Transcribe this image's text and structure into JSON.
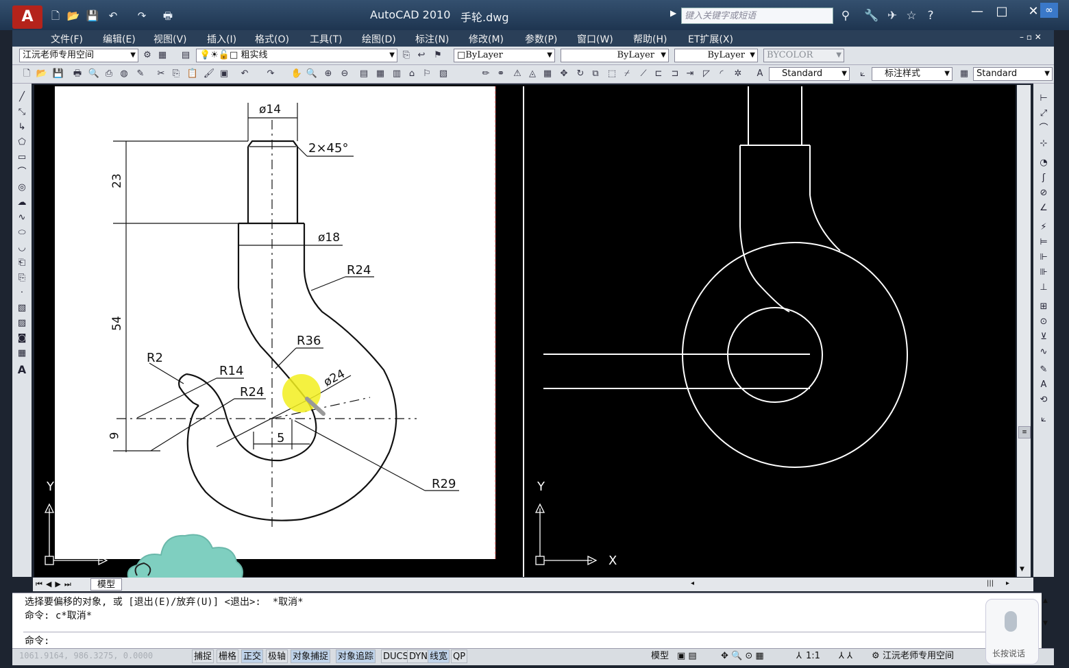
{
  "window": {
    "app_title": "AutoCAD 2010",
    "file_name": "手轮.dwg",
    "search_placeholder": "键入关键字或短语"
  },
  "menubar": {
    "items": [
      "文件(F)",
      "编辑(E)",
      "视图(V)",
      "插入(I)",
      "格式(O)",
      "工具(T)",
      "绘图(D)",
      "标注(N)",
      "修改(M)",
      "参数(P)",
      "窗口(W)",
      "帮助(H)",
      "ET扩展(X)"
    ]
  },
  "toolbar1": {
    "workspace": "江沅老师专用空间",
    "layer": "粗实线",
    "color": "ByLayer",
    "linetype": "ByLayer",
    "lineweight": "ByLayer",
    "plotstyle": "BYCOLOR"
  },
  "toolbar2": {
    "text_style": "Standard",
    "dim_style": "标注样式",
    "table_style": "Standard"
  },
  "drawing": {
    "dims": {
      "d14": "ø14",
      "chamfer": "2×45°",
      "h23": "23",
      "d18": "ø18",
      "r24_top": "R24",
      "h54": "54",
      "r36": "R36",
      "r2": "R2",
      "r14": "R14",
      "d24": "ø24",
      "r24_low": "R24",
      "h9": "9",
      "d5": "5",
      "r29": "R29"
    },
    "ucs_x": "X",
    "ucs_y": "Y"
  },
  "model_tab": "模型",
  "command": {
    "line1": "选择要偏移的对象, 或 [退出(E)/放弃(U)] <退出>:  *取消*",
    "line2": "命令: c*取消*",
    "prompt": "命令:"
  },
  "status": {
    "coords": "1061.9164, 986.3275, 0.0000",
    "buttons": [
      "捕捉",
      "栅格",
      "正交",
      "极轴",
      "对象捕捉",
      "对象追踪",
      "DUCS",
      "DYN",
      "线宽",
      "QP"
    ],
    "active": [
      "正交",
      "对象捕捉",
      "对象追踪",
      "线宽"
    ],
    "model": "模型",
    "scale": "1:1",
    "workspace": "江沅老师专用空间"
  },
  "voice": {
    "label": "长按说话"
  }
}
